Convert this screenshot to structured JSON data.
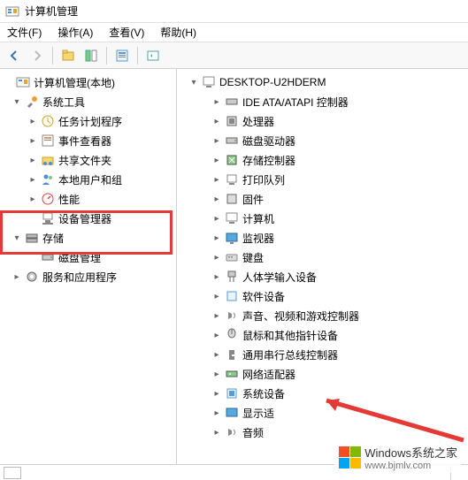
{
  "window": {
    "title": "计算机管理"
  },
  "menu": {
    "file": "文件(F)",
    "action": "操作(A)",
    "view": "查看(V)",
    "help": "帮助(H)"
  },
  "left_tree": {
    "root": "计算机管理(本地)",
    "system_tools": "系统工具",
    "task_scheduler": "任务计划程序",
    "event_viewer": "事件查看器",
    "shared_folders": "共享文件夹",
    "local_users": "本地用户和组",
    "performance": "性能",
    "device_manager": "设备管理器",
    "storage": "存储",
    "disk_mgmt": "磁盘管理",
    "services_apps": "服务和应用程序"
  },
  "right_tree": {
    "root": "DESKTOP-U2HDERM",
    "items": [
      "IDE ATA/ATAPI 控制器",
      "处理器",
      "磁盘驱动器",
      "存储控制器",
      "打印队列",
      "固件",
      "计算机",
      "监视器",
      "键盘",
      "人体学输入设备",
      "软件设备",
      "声音、视频和游戏控制器",
      "鼠标和其他指针设备",
      "通用串行总线控制器",
      "网络适配器",
      "系统设备",
      "显示适",
      "音频"
    ]
  },
  "watermark": {
    "brand": "Windows系统之家",
    "url": "www.bjmlv.com"
  }
}
